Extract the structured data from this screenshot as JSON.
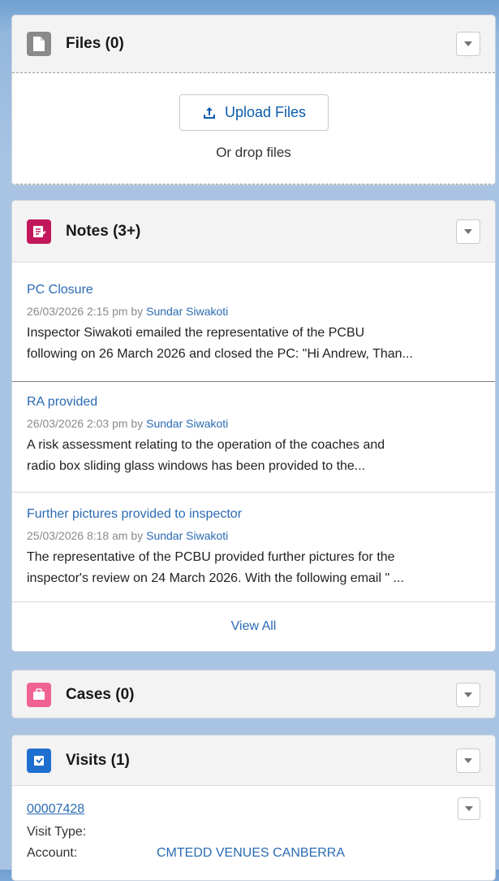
{
  "files": {
    "title": "Files (0)",
    "upload_label": "Upload Files",
    "drop_text": "Or drop files"
  },
  "notes": {
    "title": "Notes (3+)",
    "items": [
      {
        "title": "PC Closure",
        "date": "26/03/2026 2:15 pm by ",
        "author": "Sundar Siwakoti",
        "line1": "Inspector Siwakoti emailed the representative of the PCBU",
        "line2": "following on 26 March 2026 and closed the PC: \"Hi Andrew, Than..."
      },
      {
        "title": "RA provided",
        "date": "26/03/2026 2:03 pm by ",
        "author": "Sundar Siwakoti",
        "line1": "A risk assessment relating to the operation of the coaches and",
        "line2": "radio box sliding glass windows has been provided to the..."
      },
      {
        "title": "Further pictures provided to inspector",
        "date": "25/03/2026 8:18 am by ",
        "author": "Sundar Siwakoti",
        "line1": "The representative of the PCBU provided further pictures for the",
        "line2": "inspector's review on 24 March 2026. With the following email \" ..."
      }
    ],
    "view_all": "View All"
  },
  "cases": {
    "title": "Cases (0)"
  },
  "visits": {
    "title": "Visits (1)",
    "record": "00007428",
    "visit_type_label": "Visit Type:",
    "account_label": "Account:",
    "account_value": "CMTEDD VENUES CANBERRA"
  },
  "colors": {
    "files_icon": "#8a8a8a",
    "notes_icon": "#c2185b",
    "cases_icon": "#f06292",
    "visits_icon": "#1e6fd0",
    "link": "#2a6bb3"
  },
  "icons": {
    "files": "file-icon",
    "notes": "note-icon",
    "cases": "case-icon",
    "visits": "visit-icon",
    "upload": "upload-icon",
    "menu": "chevron-down-icon"
  }
}
